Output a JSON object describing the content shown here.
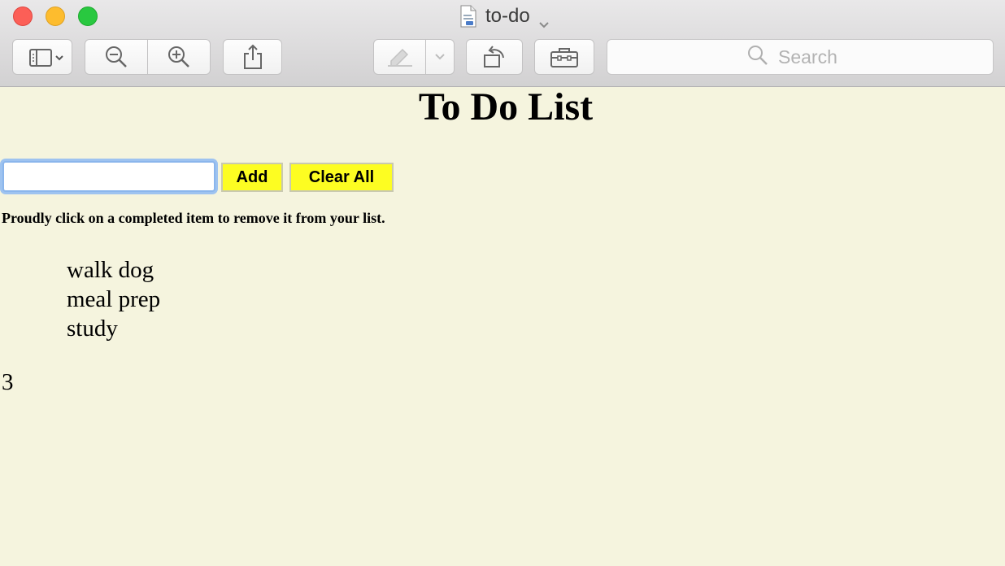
{
  "window": {
    "title": "to-do"
  },
  "toolbar": {
    "search_placeholder": "Search"
  },
  "page": {
    "heading": "To Do List",
    "input_value": "",
    "add_label": "Add",
    "clear_label": "Clear All",
    "hint": "Proudly click on a completed item to remove it from your list.",
    "items": [
      "walk dog",
      "meal prep",
      "study"
    ],
    "count": "3"
  },
  "colors": {
    "page_background": "#f5f4de",
    "button_yellow": "#fdfd22",
    "focus_ring": "#9ec3f0"
  },
  "icons": [
    "sidebar-toggle-icon",
    "zoom-out-icon",
    "zoom-in-icon",
    "share-icon",
    "markup-pen-icon",
    "rotate-icon",
    "toolbox-icon",
    "search-icon"
  ]
}
